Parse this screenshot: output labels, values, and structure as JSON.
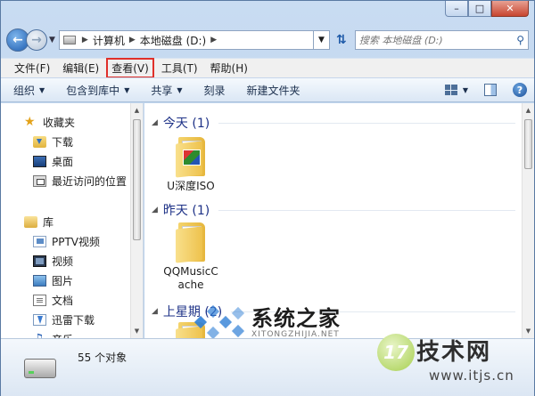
{
  "address_bar": {
    "crumbs": [
      "计算机",
      "本地磁盘 (D:)"
    ]
  },
  "search": {
    "placeholder": "搜索 本地磁盘 (D:)"
  },
  "menu": [
    "文件(F)",
    "编辑(E)",
    "查看(V)",
    "工具(T)",
    "帮助(H)"
  ],
  "highlighted_menu": "查看(V)",
  "toolbar": {
    "organize": "组织",
    "include_in_library": "包含到库中",
    "share": "共享",
    "burn": "刻录",
    "new_folder": "新建文件夹"
  },
  "nav": {
    "favorites_label": "收藏夹",
    "favorites": [
      "下载",
      "桌面",
      "最近访问的位置"
    ],
    "library_label": "库",
    "libraries": [
      "PPTV视频",
      "视频",
      "图片",
      "文档",
      "迅雷下载",
      "音乐"
    ]
  },
  "groups": [
    {
      "label": "今天 (1)",
      "items": [
        "U深度ISO"
      ]
    },
    {
      "label": "昨天 (1)",
      "items": [
        "QQMusicC\nache"
      ]
    },
    {
      "label": "上星期 (2)"
    }
  ],
  "status": {
    "count": "55 个对象"
  },
  "watermarks": {
    "xitong_cn": "系统之家",
    "xitong_en": "XITONGZHIJIA.NET",
    "brand_badge": "17",
    "brand_name": "技术网",
    "brand_url": "www.itjs.cn"
  },
  "colors": {
    "highlight_border": "#e0302a",
    "group_header": "#1e3287",
    "window_frame": "#b9d1ea"
  }
}
